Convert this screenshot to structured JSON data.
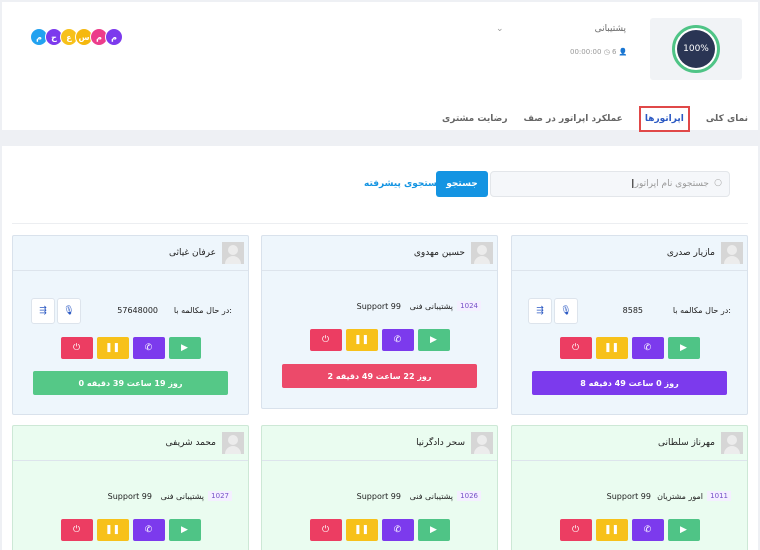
{
  "header": {
    "avatars": [
      {
        "letter": "م",
        "color": "#22a2f0"
      },
      {
        "letter": "ح",
        "color": "#7c3aed"
      },
      {
        "letter": "ع",
        "color": "#f7c11a"
      },
      {
        "letter": "س",
        "color": "#f5b80f"
      },
      {
        "letter": "م",
        "color": "#ec3d8b"
      },
      {
        "letter": "م",
        "color": "#7c3aed"
      }
    ],
    "status_percent": "100%",
    "department": "پشتیبانی",
    "meta_count": "6",
    "meta_time": "00:00:00"
  },
  "tabs": [
    {
      "label": "نمای کلی"
    },
    {
      "label": "اپراتورها"
    },
    {
      "label": "عملکرد اپراتور در صف"
    },
    {
      "label": "رضایت مشتری"
    }
  ],
  "search": {
    "placeholder": "جستجوی نام اپراتور",
    "button": "جستجو",
    "advanced": "جستجوی پیشرفته"
  },
  "colors": {
    "play": "#4fc486",
    "call": "#7c3aed",
    "pause": "#f7c11a",
    "power": "#ec3d62",
    "blue_bar": "#7c3aed",
    "red_bar": "#ec4a6a",
    "green_bar": "#55c887"
  },
  "cards": [
    {
      "name": "مازیار صدری",
      "state": "in-call",
      "call_label": "در حال مکالمه با:",
      "call_number": "8585",
      "bar": "8 روز 0 ساعت 49 دقیقه"
    },
    {
      "name": "حسین مهدوی",
      "state": "queue",
      "queue_id": "1024",
      "queue_name": "پشتیبانی فنی",
      "queue_tag": "Support 99",
      "bar": "2 روز 22 ساعت 49 دقیقه"
    },
    {
      "name": "عرفان غیاثی",
      "state": "in-call",
      "call_label": "در حال مکالمه با:",
      "call_number": "57648000",
      "bar": "0 روز 19 ساعت 39 دقیقه"
    },
    {
      "name": "مهرناز سلطانی",
      "state": "queue",
      "queue_id": "1011",
      "queue_name": "امور مشتریان",
      "queue_tag": "Support 99"
    },
    {
      "name": "سحر دادگرنیا",
      "state": "queue",
      "queue_id": "1026",
      "queue_name": "پشتیبانی فنی",
      "queue_tag": "Support 99"
    },
    {
      "name": "محمد شریفی",
      "state": "queue",
      "queue_id": "1027",
      "queue_name": "پشتیبانی فنی",
      "queue_tag": "Support 99"
    }
  ]
}
